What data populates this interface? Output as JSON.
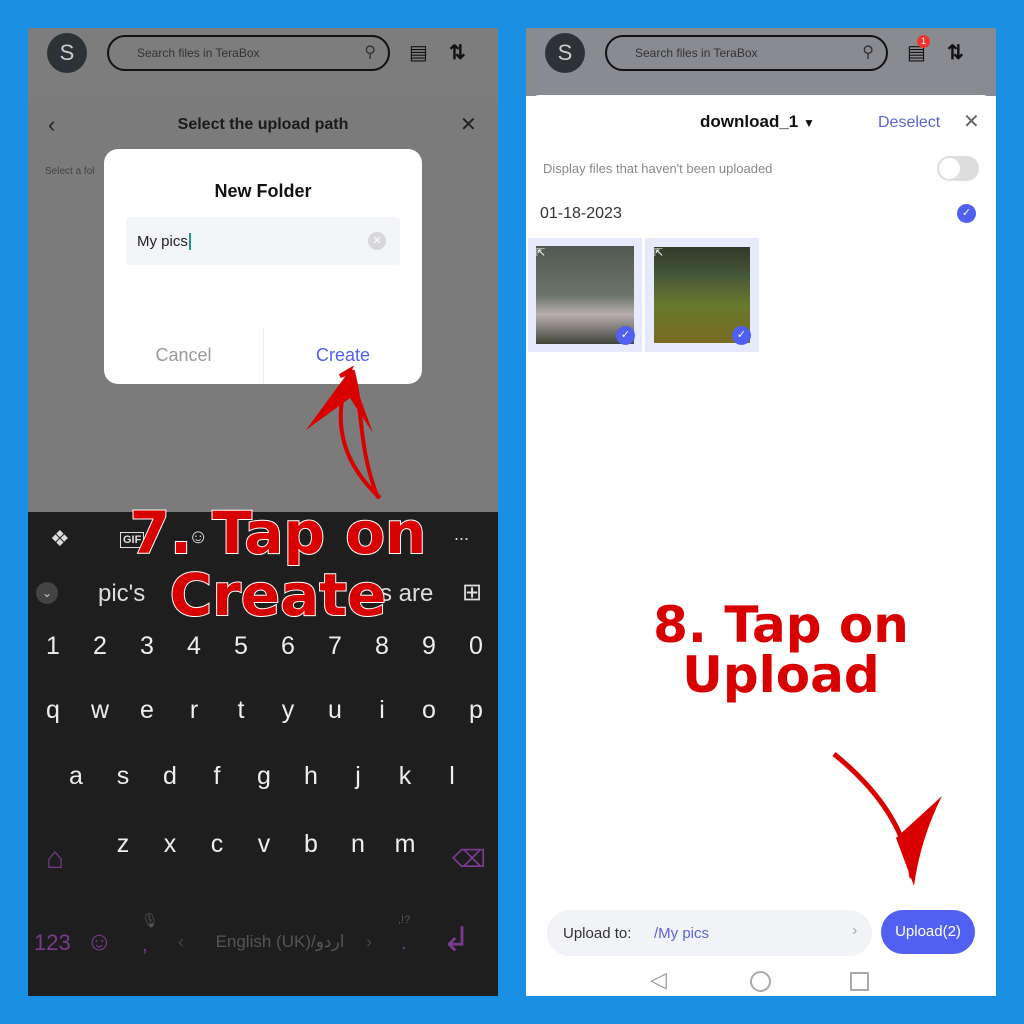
{
  "left": {
    "topbar": {
      "avatar_letter": "S",
      "search_placeholder": "Search files in TeraBox"
    },
    "upload_path": {
      "title": "Select the upload path",
      "hint": "Select a fol"
    },
    "dialog": {
      "title": "New Folder",
      "input_value": "My pics",
      "cancel_label": "Cancel",
      "create_label": "Create"
    },
    "keyboard": {
      "suggestions": [
        "pic's",
        "s are"
      ],
      "gif_label": "GIF",
      "more_label": "...",
      "rows": [
        [
          "1",
          "2",
          "3",
          "4",
          "5",
          "6",
          "7",
          "8",
          "9",
          "0"
        ],
        [
          "q",
          "w",
          "e",
          "r",
          "t",
          "y",
          "u",
          "i",
          "o",
          "p"
        ],
        [
          "a",
          "s",
          "d",
          "f",
          "g",
          "h",
          "j",
          "k",
          "l"
        ],
        [
          "z",
          "x",
          "c",
          "v",
          "b",
          "n",
          "m"
        ]
      ],
      "numeric_label": "123",
      "space_label": "English (UK)/اردو",
      "comma": ",",
      "period": ".",
      "punct_label": ",!?"
    },
    "annotation": {
      "line1": "7. Tap on",
      "line2": "Create"
    }
  },
  "right": {
    "topbar": {
      "avatar_letter": "S",
      "search_placeholder": "Search files in TeraBox",
      "badge": "1"
    },
    "sheet": {
      "folder": "download_1",
      "deselect_label": "Deselect",
      "toggle_label": "Display files that haven't been uploaded",
      "toggle_on": false,
      "date": "01-18-2023",
      "upload_to_label": "Upload to:",
      "upload_path": "/My pics",
      "upload_button": "Upload(2)"
    },
    "annotation": {
      "line1": "8. Tap on",
      "line2": "Upload"
    }
  },
  "colors": {
    "accent": "#5160f0",
    "annotation": "#d90000",
    "background": "#1b8fe3",
    "keyboard_accent": "#7a3a8e"
  }
}
